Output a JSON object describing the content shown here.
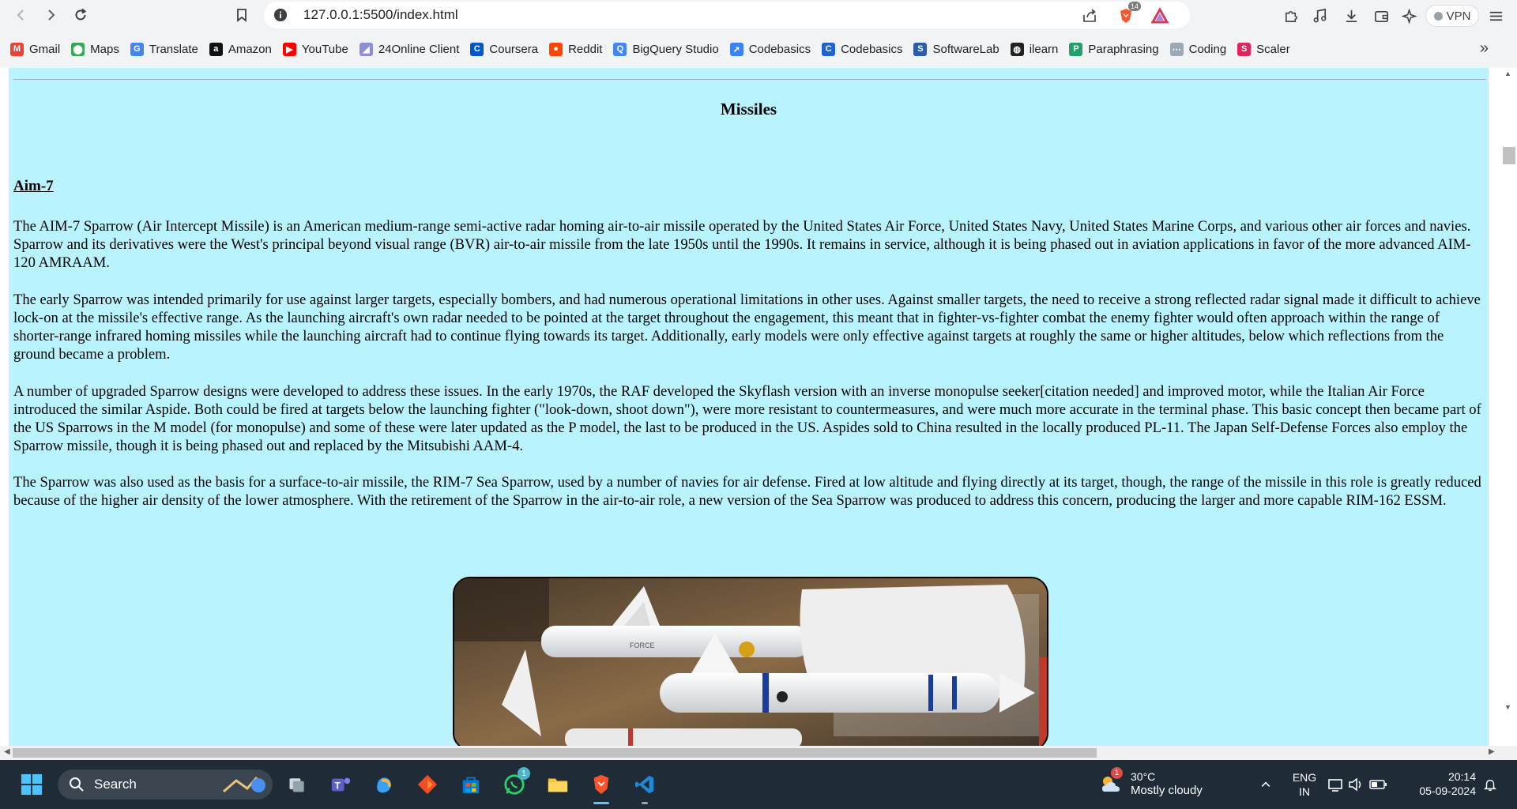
{
  "browser": {
    "url": "127.0.0.1:5500/index.html",
    "shields_badge": "14",
    "vpn_label": "VPN"
  },
  "bookmarks": [
    {
      "label": "Gmail",
      "icon": "gmail-icon",
      "color": "#ea4335",
      "glyph": "M"
    },
    {
      "label": "Maps",
      "icon": "maps-icon",
      "color": "#34a853",
      "glyph": "⬤"
    },
    {
      "label": "Translate",
      "icon": "translate-icon",
      "color": "#4285f4",
      "glyph": "G"
    },
    {
      "label": "Amazon",
      "icon": "amazon-icon",
      "color": "#111111",
      "glyph": "a"
    },
    {
      "label": "YouTube",
      "icon": "youtube-icon",
      "color": "#ff0000",
      "glyph": "▶"
    },
    {
      "label": "24Online Client",
      "icon": "24online-icon",
      "color": "#8e8ed8",
      "glyph": "◢"
    },
    {
      "label": "Coursera",
      "icon": "coursera-icon",
      "color": "#0056d2",
      "glyph": "C"
    },
    {
      "label": "Reddit",
      "icon": "reddit-icon",
      "color": "#ff4500",
      "glyph": "●"
    },
    {
      "label": "BigQuery Studio",
      "icon": "bigquery-icon",
      "color": "#4285f4",
      "glyph": "Q"
    },
    {
      "label": "Codebasics",
      "icon": "codebasics-rocket-icon",
      "color": "#3b82f6",
      "glyph": "➚"
    },
    {
      "label": "Codebasics",
      "icon": "codebasics-icon",
      "color": "#1e63d6",
      "glyph": "C"
    },
    {
      "label": "SoftwareLab",
      "icon": "softwarelab-icon",
      "color": "#2a5caa",
      "glyph": "S"
    },
    {
      "label": "ilearn",
      "icon": "ilearn-icon",
      "color": "#222222",
      "glyph": "◍"
    },
    {
      "label": "Paraphrasing",
      "icon": "paraphrasing-icon",
      "color": "#22a06b",
      "glyph": "P"
    },
    {
      "label": "Coding",
      "icon": "coding-icon",
      "color": "#9aa8b8",
      "glyph": "⋯"
    },
    {
      "label": "Scaler",
      "icon": "scaler-icon",
      "color": "#e0245e",
      "glyph": "S"
    }
  ],
  "page": {
    "title": "Missiles",
    "section_heading": "Aim-7",
    "paragraphs": [
      "The AIM-7 Sparrow (Air Intercept Missile) is an American medium-range semi-active radar homing air-to-air missile operated by the United States Air Force, United States Navy, United States Marine Corps, and various other air forces and navies. Sparrow and its derivatives were the West's principal beyond visual range (BVR) air-to-air missile from the late 1950s until the 1990s. It remains in service, although it is being phased out in aviation applications in favor of the more advanced AIM-120 AMRAAM.",
      "The early Sparrow was intended primarily for use against larger targets, especially bombers, and had numerous operational limitations in other uses. Against smaller targets, the need to receive a strong reflected radar signal made it difficult to achieve lock-on at the missile's effective range. As the launching aircraft's own radar needed to be pointed at the target throughout the engagement, this meant that in fighter-vs-fighter combat the enemy fighter would often approach within the range of shorter-range infrared homing missiles while the launching aircraft had to continue flying towards its target. Additionally, early models were only effective against targets at roughly the same or higher altitudes, below which reflections from the ground became a problem.",
      "A number of upgraded Sparrow designs were developed to address these issues. In the early 1970s, the RAF developed the Skyflash version with an inverse monopulse seeker[citation needed] and improved motor, while the Italian Air Force introduced the similar Aspide. Both could be fired at targets below the launching fighter (\"look-down, shoot down\"), were more resistant to countermeasures, and were much more accurate in the terminal phase. This basic concept then became part of the US Sparrows in the M model (for monopulse) and some of these were later updated as the P model, the last to be produced in the US. Aspides sold to China resulted in the locally produced PL-11. The Japan Self-Defense Forces also employ the Sparrow missile, though it is being phased out and replaced by the Mitsubishi AAM-4.",
      "The Sparrow was also used as the basis for a surface-to-air missile, the RIM-7 Sea Sparrow, used by a number of navies for air defense. Fired at low altitude and flying directly at its target, though, the range of the missile in this role is greatly reduced because of the higher air density of the lower atmosphere. With the retirement of the Sparrow in the air-to-air role, a new version of the Sea Sparrow was produced to address this concern, producing the larger and more capable RIM-162 ESSM."
    ],
    "background_color": "#b9f3fe"
  },
  "taskbar": {
    "search_label": "Search",
    "whatsapp_badge": "1",
    "weather_badge": "1",
    "weather_temp": "30°C",
    "weather_desc": "Mostly cloudy",
    "lang_line1": "ENG",
    "lang_line2": "IN",
    "time": "20:14",
    "date": "05-09-2024"
  }
}
